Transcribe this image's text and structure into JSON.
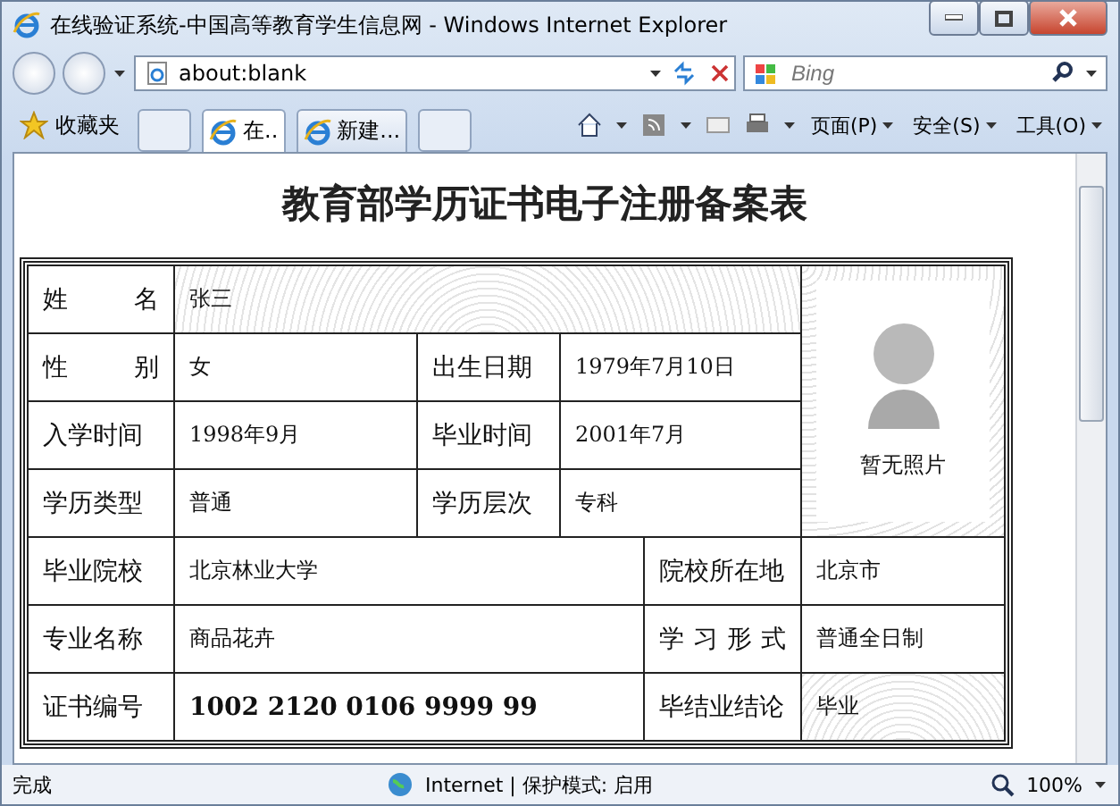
{
  "window": {
    "title": "在线验证系统-中国高等教育学生信息网 - Windows Internet Explorer"
  },
  "address_bar": {
    "url": "about:blank"
  },
  "search": {
    "placeholder": "Bing"
  },
  "favorites": {
    "label": "收藏夹"
  },
  "tabs": [
    {
      "label": "在..",
      "selected": true
    },
    {
      "label": "新建...",
      "selected": false
    }
  ],
  "commands": [
    "页面(P)",
    "安全(S)",
    "工具(O)"
  ],
  "document": {
    "title": "教育部学历证书电子注册备案表",
    "name_row": {
      "label": "姓名",
      "value": "张三"
    },
    "pair_rows": [
      [
        {
          "label": "性别",
          "spaced": true,
          "value": "女"
        },
        {
          "label": "出生日期",
          "spaced": false,
          "value": "1979年7月10日"
        }
      ],
      [
        {
          "label": "入学时间",
          "spaced": false,
          "value": "1998年9月"
        },
        {
          "label": "毕业时间",
          "spaced": false,
          "value": "2001年7月"
        }
      ],
      [
        {
          "label": "学历类型",
          "spaced": false,
          "value": "普通"
        },
        {
          "label": "学历层次",
          "spaced": false,
          "value": "专科"
        }
      ]
    ],
    "wide_rows": [
      [
        {
          "label": "毕业院校",
          "spaced": false,
          "value": "北京林业大学",
          "bold": false
        },
        {
          "label": "院校所在地",
          "spaced": false,
          "value": "北京市",
          "bold": false
        }
      ],
      [
        {
          "label": "专业名称",
          "spaced": false,
          "value": "商品花卉",
          "bold": false
        },
        {
          "label": "学习形式",
          "spaced": true,
          "value": "普通全日制",
          "bold": false
        }
      ],
      [
        {
          "label": "证书编号",
          "spaced": false,
          "value": "1002 2120 0106 9999 99",
          "bold": true
        },
        {
          "label": "毕结业结论",
          "spaced": false,
          "value": "毕业",
          "bold": false
        }
      ]
    ],
    "photo_caption": "暂无照片"
  },
  "status_bar": {
    "status": "完成",
    "zone": "Internet | 保护模式: 启用",
    "zoom": "100%"
  }
}
